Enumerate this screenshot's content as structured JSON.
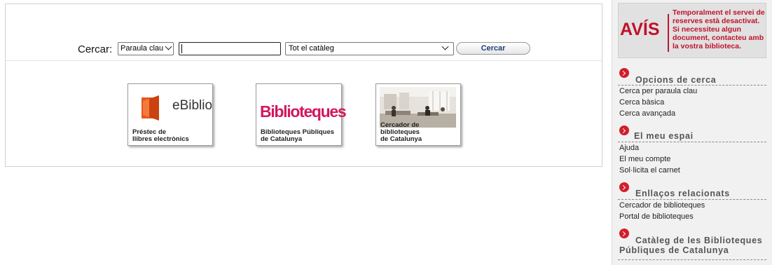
{
  "search": {
    "label": "Cercar:",
    "type_value": "Paraula clau",
    "query": "",
    "catalog_value": "Tot el catàleg",
    "button_label": "Cercar"
  },
  "tiles": {
    "ebiblio": {
      "logo_text": "eBiblio",
      "caption": "Préstec de\nllibres electrònics"
    },
    "biblio": {
      "logo_text": "Biblioteques",
      "caption": "Biblioteques Públiques\nde Catalunya"
    },
    "cercador": {
      "caption": "Cercador de biblioteques\nde Catalunya"
    }
  },
  "notice": {
    "title": "AVÍS",
    "text": "Temporalment el servei de reserves està desactivat. Si necessiteu algun document, contacteu amb la vostra biblioteca."
  },
  "sidebar": {
    "sections": [
      {
        "title": "Opcions de cerca",
        "links": [
          "Cerca per paraula clau",
          "Cerca bàsica",
          "Cerca avançada"
        ]
      },
      {
        "title": "El meu espai",
        "links": [
          "Ajuda",
          "El meu compte",
          "Sol·licita el carnet"
        ]
      },
      {
        "title": "Enllaços relacionats",
        "links": [
          "Cercador de biblioteques",
          "Portal de biblioteques"
        ]
      },
      {
        "title": "Catàleg de les Biblioteques Públiques de Catalunya",
        "links": []
      }
    ]
  },
  "colors": {
    "accent_red": "#c0122b",
    "biblio_pink": "#d3175e",
    "ebiblio_orange": "#e8561c"
  },
  "icons": [
    "chevron-down-icon",
    "arrow-right-circle-icon",
    "ebook-icon"
  ]
}
